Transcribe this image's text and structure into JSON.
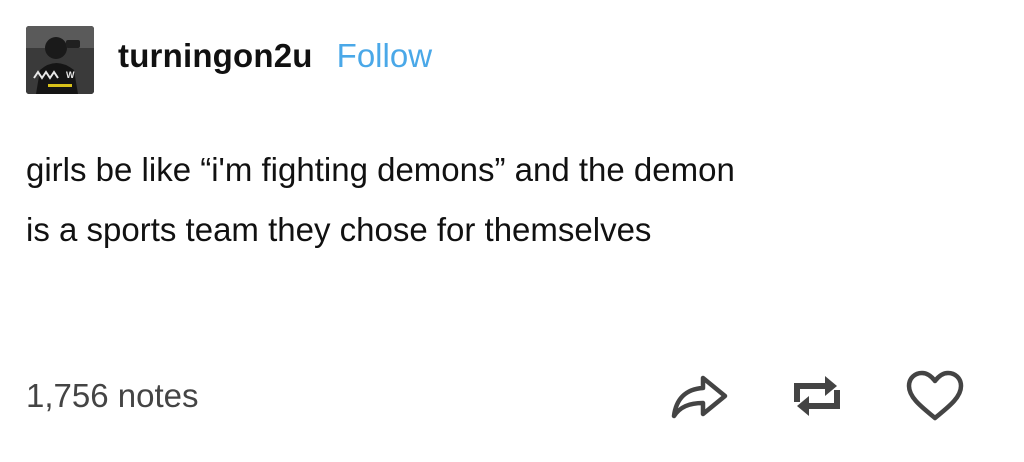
{
  "post": {
    "username": "turningon2u",
    "follow_label": "Follow",
    "avatar_text": "ᴧᴧᴧᴧW",
    "body_line1": "girls be like “i'm fighting demons” and the demon",
    "body_line2": "is a sports team they chose for themselves",
    "notes": "1,756 notes"
  },
  "icons": {
    "share": "share-arrow-icon",
    "reblog": "reblog-icon",
    "like": "heart-icon"
  },
  "colors": {
    "follow": "#4aa8e8",
    "text": "#111111",
    "muted": "#444444"
  }
}
